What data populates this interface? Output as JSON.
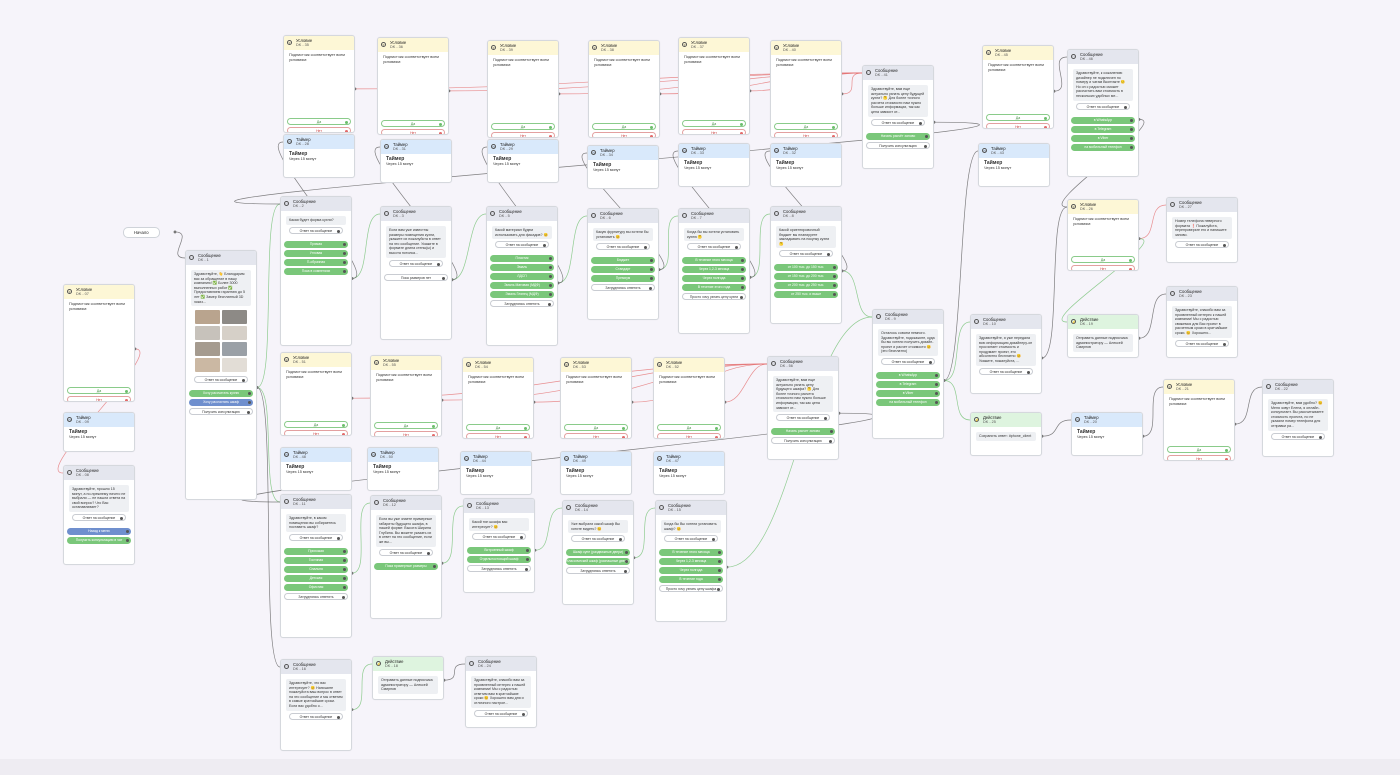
{
  "start_label": "Начало",
  "labels": {
    "condition_text": "Подпистчик соответствует всем условиям:",
    "yes": "Да",
    "no": "Нет",
    "reply": "Ответ на сообщение",
    "timer_value": "Через 15 минут",
    "timer_title": "Таймер"
  },
  "nodes": [
    {
      "id": "n-uslovie-07",
      "type": "cond",
      "title": "Условие",
      "sub": "DK - 07"
    },
    {
      "id": "n-timer-09",
      "type": "timer",
      "title": "Таймер",
      "sub": "DK - 09"
    },
    {
      "id": "n-msg-08",
      "type": "msg",
      "title": "Сообщение",
      "sub": "DK - 08",
      "text": "Здравствуйте, прошло 15 минут, а по-прежнему ничего не выбрали — не нашли ответа на свой вопрос? Что Вас останавливает?",
      "buttons": [
        "Назад к меню",
        "Получить консультацию в чат"
      ]
    },
    {
      "id": "n-msg-01",
      "type": "msg",
      "title": "Сообщение",
      "sub": "DK - 1",
      "text": "Здравствуйте, 👋 Благодарим вас за обращение в нашу компанию! ✅ Более 3000 выполненных работ ✅ Предоставляем гарантию до 5 лет ✅ Замер бесплатный 3D эскиз...",
      "buttons": [
        "Хочу рассчитать кухню",
        "Хочу рассчитать шкаф",
        "Получить консультацию"
      ]
    },
    {
      "id": "n-uslovie-35",
      "type": "cond",
      "title": "Условие",
      "sub": "DK - 35"
    },
    {
      "id": "n-timer-28",
      "type": "timer",
      "title": "Таймер",
      "sub": "DK - 28"
    },
    {
      "id": "n-msg-02",
      "type": "msg",
      "title": "Сообщение",
      "sub": "DK - 2",
      "text": "Какая будет форма кухни?",
      "buttons": [
        "Прямая",
        "Угловая",
        "П-образная",
        "Пока в сомнениях"
      ]
    },
    {
      "id": "n-uslovie-36",
      "type": "cond",
      "title": "Условие",
      "sub": "DK - 36"
    },
    {
      "id": "n-timer-31",
      "type": "timer",
      "title": "Таймер",
      "sub": "DK - 31"
    },
    {
      "id": "n-msg-03",
      "type": "msg",
      "title": "Сообщение",
      "sub": "DK - 3",
      "text": "Если вам уже известны размеры помещения кухни, укажите их пожалуйста в ответ на это сообщение. Укажите в формате длина стены(ы) и высота потолка...",
      "buttons": [
        "Пока размеров нет"
      ]
    },
    {
      "id": "n-uslovie-39",
      "type": "cond",
      "title": "Условие",
      "sub": "DK - 39"
    },
    {
      "id": "n-timer-29",
      "type": "timer",
      "title": "Таймер",
      "sub": "DK - 29"
    },
    {
      "id": "n-msg-05",
      "type": "msg",
      "title": "Сообщение",
      "sub": "DK - 5",
      "text": "Какой материал будем использовать для фасадов? 😊",
      "buttons": [
        "Пластик",
        "Эмаль",
        "ЛДСП",
        "Эмаль Матовая (МДФ)",
        "Эмаль Глянец (МДФ)",
        "Затрудняюсь ответить"
      ]
    },
    {
      "id": "n-uslovie-38",
      "type": "cond",
      "title": "Условие",
      "sub": "DK - 38"
    },
    {
      "id": "n-timer-34",
      "type": "timer",
      "title": "Таймер",
      "sub": "DK - 34"
    },
    {
      "id": "n-msg-06",
      "type": "msg",
      "title": "Сообщение",
      "sub": "DK - 6",
      "text": "Какую фурнитуру вы хотели бы установить 😊",
      "buttons": [
        "Бюджет",
        "Стандарт",
        "Премиум",
        "Затрудняюсь ответить"
      ]
    },
    {
      "id": "n-uslovie-37",
      "type": "cond",
      "title": "Условие",
      "sub": "DK - 37"
    },
    {
      "id": "n-timer-33",
      "type": "timer",
      "title": "Таймер",
      "sub": "DK - 33"
    },
    {
      "id": "n-msg-07",
      "type": "msg",
      "title": "Сообщение",
      "sub": "DK - 7",
      "text": "Когда бы вы хотели установить кухню 🤔",
      "buttons": [
        "В течение этого месяца",
        "Через 1,2-3 месяца",
        "Через полгода",
        "В течение этого года",
        "Просто хочу узнать цену кухни"
      ]
    },
    {
      "id": "n-uslovie-40",
      "type": "cond",
      "title": "Условие",
      "sub": "DK - 40"
    },
    {
      "id": "n-timer-32",
      "type": "timer",
      "title": "Таймер",
      "sub": "DK - 32"
    },
    {
      "id": "n-msg-08b",
      "type": "msg",
      "title": "Сообщение",
      "sub": "DK - 8",
      "text": "Какой ориентировочный бюджет вы планируете закладывать на покупку кухни 🤔",
      "buttons": [
        "от 100 тыс. до 150 тыс.",
        "от 150 тыс. до 200 тыс.",
        "от 200 тыс. до 250 тыс.",
        "от 250 тыс. и выше"
      ]
    },
    {
      "id": "n-msg-41",
      "type": "msg",
      "title": "Сообщение",
      "sub": "DK - 41",
      "text": "Здравствуйте, вам еще актуально узнать цену будущей кухни? 🤔 Для более точного расчета стоимости нам нужно больше информации, так как цена зависит от...",
      "buttons": [
        "Начать расчёт заново",
        "Получить консультацию"
      ]
    },
    {
      "id": "n-msg-09",
      "type": "msg",
      "title": "Сообщение",
      "sub": "DK - 9",
      "text": "Осталось совсем немного. Здравствуйте, подскажите, куда бы вы хотели получить дизайн-проект и расчет стоимости 😊 (это бесплатно)",
      "buttons": [
        "в WhatsApp",
        "в Telegram",
        "в Viber",
        "на мобильный телефон"
      ]
    },
    {
      "id": "n-uslovie-45",
      "type": "cond",
      "title": "Условие",
      "sub": "DK - 45"
    },
    {
      "id": "n-timer-43",
      "type": "timer",
      "title": "Таймер",
      "sub": "DK - 43"
    },
    {
      "id": "n-msg-46",
      "type": "msg",
      "title": "Сообщение",
      "sub": "DK - 46",
      "text": "Здравствуйте, к сожалению дизайнер не подключен по номеру и чатам Вконтакте 😔 Но он с радостью сможет рассчитать вам стоимость в нескольких удобных ме...",
      "buttons": [
        "в WhatsApp",
        "в Telegram",
        "в Viber",
        "на мобильный телефон"
      ]
    },
    {
      "id": "n-uslovie-26",
      "type": "cond",
      "title": "Условие",
      "sub": "DK - 26"
    },
    {
      "id": "n-msg-27",
      "type": "msg",
      "title": "Сообщение",
      "sub": "DK - 27",
      "text": "Номер телефона неверного формата ❗ Пожалуйста, перепроверьте его и напишите заново.",
      "buttons": []
    },
    {
      "id": "n-action-19",
      "type": "action",
      "title": "Действие",
      "sub": "DK - 19",
      "text": "Отправить данные подписчика администратору — Алексей Смирнов"
    },
    {
      "id": "n-msg-23",
      "type": "msg",
      "title": "Сообщение",
      "sub": "DK - 23",
      "text": "Здравствуйте, спасибо вам за проявленный интерес к нашей компании! Мы с радостью свяжемся для Вас проект в расчетным сроки в кратчайшие сроки. 😊 Хорошего...",
      "buttons": []
    },
    {
      "id": "n-msg-10",
      "type": "msg",
      "title": "Сообщение",
      "sub": "DK - 10",
      "text": "Здравствуйте, я уже передала всю информацию дизайнеру-он просчитает стоимость и продумает проект, это абсолютно бесплатно 😊 Укажите, пожалуйста, ...",
      "buttons": []
    },
    {
      "id": "n-action-25",
      "type": "action",
      "title": "Действие",
      "sub": "DK - 25",
      "text": "Сохранить ответ: #phone_client"
    },
    {
      "id": "n-timer-20",
      "type": "timer",
      "title": "Таймер",
      "sub": "DK - 20"
    },
    {
      "id": "n-uslovie-21",
      "type": "cond",
      "title": "Условие",
      "sub": "DK - 21"
    },
    {
      "id": "n-msg-22",
      "type": "msg",
      "title": "Сообщение",
      "sub": "DK - 22",
      "text": "Здравствуйте, вам удобно? 😊 Меня зовут Елена, я онлайн-консультант. Вы рассчитываете стоимость проекта, но не указали номер телефона для отправки ра...",
      "buttons": []
    },
    {
      "id": "n-uslovie-51",
      "type": "cond",
      "title": "Условие",
      "sub": "DK - 51"
    },
    {
      "id": "n-timer-48",
      "type": "timer",
      "title": "Таймер",
      "sub": "DK - 48"
    },
    {
      "id": "n-msg-11",
      "type": "msg",
      "title": "Сообщение",
      "sub": "DK - 11",
      "text": "Здравствуйте, в каком помещении вы собираетесь поставить шкаф?",
      "buttons": [
        "Прихожая",
        "Гостиная",
        "Спальня",
        "Детская",
        "Офисная",
        "Затрудняюсь ответить"
      ]
    },
    {
      "id": "n-uslovie-55",
      "type": "cond",
      "title": "Условие",
      "sub": "DK - 55"
    },
    {
      "id": "n-timer-50",
      "type": "timer",
      "title": "Таймер",
      "sub": "DK - 50"
    },
    {
      "id": "n-msg-12",
      "type": "msg",
      "title": "Сообщение",
      "sub": "DK - 12",
      "text": "Если вы уже знаете примерные габариты будущего шкафа, в нашей форме: Высота Ширина Глубина. Вы можете указать их в ответ на это сообщение, если же вы...",
      "buttons": [
        "Пока примерные размеры"
      ]
    },
    {
      "id": "n-uslovie-54",
      "type": "cond",
      "title": "Условие",
      "sub": "DK - 54"
    },
    {
      "id": "n-timer-44",
      "type": "timer",
      "title": "Таймер",
      "sub": "DK - 44"
    },
    {
      "id": "n-msg-13",
      "type": "msg",
      "title": "Сообщение",
      "sub": "DK - 13",
      "text": "Какой тип шкафа вас интересует? 😊",
      "buttons": [
        "Встроенный шкаф",
        "Отдельностоящий шкаф",
        "Затрудняюсь ответить"
      ]
    },
    {
      "id": "n-uslovie-53",
      "type": "cond",
      "title": "Условие",
      "sub": "DK - 53"
    },
    {
      "id": "n-timer-49",
      "type": "timer",
      "title": "Таймер",
      "sub": "DK - 49"
    },
    {
      "id": "n-msg-14",
      "type": "msg",
      "title": "Сообщение",
      "sub": "DK - 14",
      "text": "Уже выбрали какой шкаф Вы хотите видеть? 😊",
      "buttons": [
        "Шкаф купе (раздвижные двери)",
        "Классический шкаф (распашные двери)",
        "Затрудняюсь ответить"
      ]
    },
    {
      "id": "n-uslovie-52",
      "type": "cond",
      "title": "Условие",
      "sub": "DK - 52"
    },
    {
      "id": "n-timer-47",
      "type": "timer",
      "title": "Таймер",
      "sub": "DK - 47"
    },
    {
      "id": "n-msg-15",
      "type": "msg",
      "title": "Сообщение",
      "sub": "DK - 15",
      "text": "Когда бы Вы хотели установить шкаф? 😊",
      "buttons": [
        "В течение этого месяца",
        "Через 1,2-3 месяца",
        "Через полгода",
        "В течение года",
        "Просто хочу узнать цену шкафа"
      ]
    },
    {
      "id": "n-msg-56",
      "type": "msg",
      "title": "Сообщение",
      "sub": "DK - 56",
      "text": "Здравствуйте, вам еще актуально узнать цену будущего шкафа? 🤔 Для более точного расчета стоимости нам нужно больше информации, так как цена зависит от...",
      "buttons": [
        "Начать расчет заново",
        "Получить консультацию"
      ]
    },
    {
      "id": "n-msg-16",
      "type": "msg",
      "title": "Сообщение",
      "sub": "DK - 16",
      "text": "Здравствуйте, что вас интересует? 😊 Напишите пожалуйста ваш вопрос в ответ на это сообщение и мы ответим в самые кратчайшие сроки. Если вас удобно о...",
      "buttons": []
    },
    {
      "id": "n-action-18",
      "type": "action",
      "title": "Действие",
      "sub": "DK - 18",
      "text": "Отправить данные подписчика администратору — Алексей Смирнов"
    },
    {
      "id": "n-msg-24",
      "type": "msg",
      "title": "Сообщение",
      "sub": "DK - 24",
      "text": "Здравствуйте, спасибо вам за проявленный интерес к нашей компании! Мы с радостью ответим вам в кратчайшие сроки 😊 Хорошего вам дня и отличного настрое...",
      "buttons": []
    }
  ]
}
